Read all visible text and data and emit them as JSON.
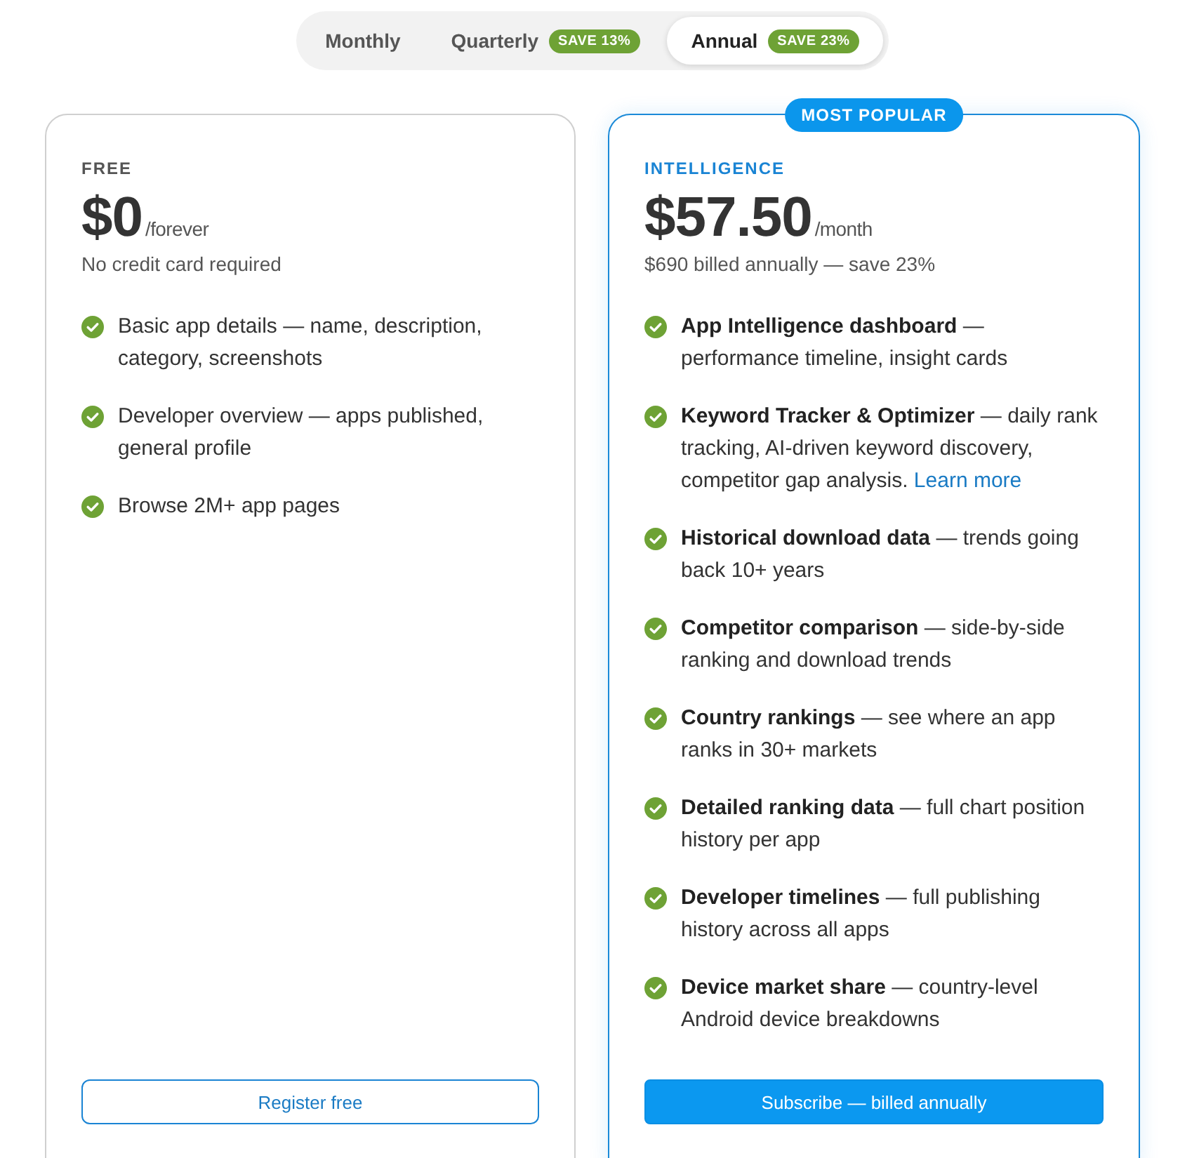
{
  "billing_toggle": {
    "options": [
      {
        "label": "Monthly",
        "selected": false
      },
      {
        "label": "Quarterly",
        "badge": "SAVE 13%",
        "selected": false
      },
      {
        "label": "Annual",
        "badge": "SAVE 23%",
        "selected": true
      }
    ]
  },
  "plans": [
    {
      "name": "FREE",
      "highlighted": false,
      "price": "$0",
      "period": "/forever",
      "note": "No credit card required",
      "features": [
        {
          "text": "Basic app details — name, description, category, screenshots"
        },
        {
          "text": "Developer overview — apps published, general profile"
        },
        {
          "text": "Browse 2M+ app pages"
        }
      ],
      "button": "Register free"
    },
    {
      "name": "INTELLIGENCE",
      "highlighted": true,
      "ribbon": "MOST POPULAR",
      "price": "$57.50",
      "period": "/month",
      "note": "$690 billed annually — save 23%",
      "features": [
        {
          "text": "**App Intelligence dashboard** — performance timeline, insight cards"
        },
        {
          "text": "**Keyword Tracker & Optimizer** — daily rank tracking, AI-driven keyword discovery, competitor gap analysis.",
          "link": "Learn more"
        },
        {
          "text": "**Historical download data** — trends going back 10+ years"
        },
        {
          "text": "**Competitor comparison** — side-by-side ranking and download trends"
        },
        {
          "text": "**Country rankings** — see where an app ranks in 30+ markets"
        },
        {
          "text": "**Detailed ranking data** — full chart position history per app"
        },
        {
          "text": "**Developer timelines** — full publishing history across all apps"
        },
        {
          "text": "**Device market share** — country-level Android device breakdowns"
        }
      ],
      "button": "Subscribe — billed annually"
    }
  ]
}
